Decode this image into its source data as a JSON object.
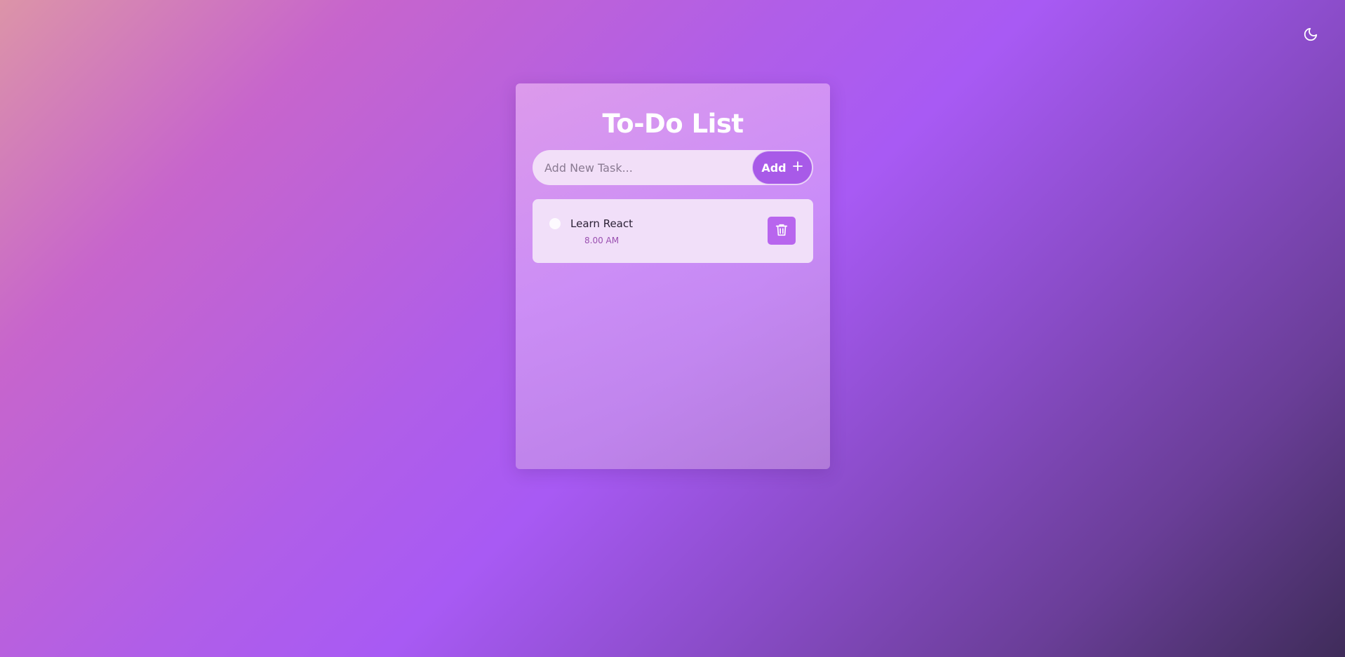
{
  "theme_toggle": {
    "icon": "moon-icon"
  },
  "app": {
    "title": "To-Do List",
    "input": {
      "placeholder": "Add New Task...",
      "value": ""
    },
    "add_button": {
      "label": "Add",
      "icon": "plus-icon"
    },
    "tasks": [
      {
        "text": "Learn React",
        "time": "8.00 AM",
        "completed": false,
        "delete_icon": "trash-icon"
      }
    ]
  },
  "colors": {
    "accent": "#a85ae8",
    "card_item_bg": "#f1dff9",
    "time_text": "#9a4fb0",
    "title_text": "#ffffff"
  }
}
